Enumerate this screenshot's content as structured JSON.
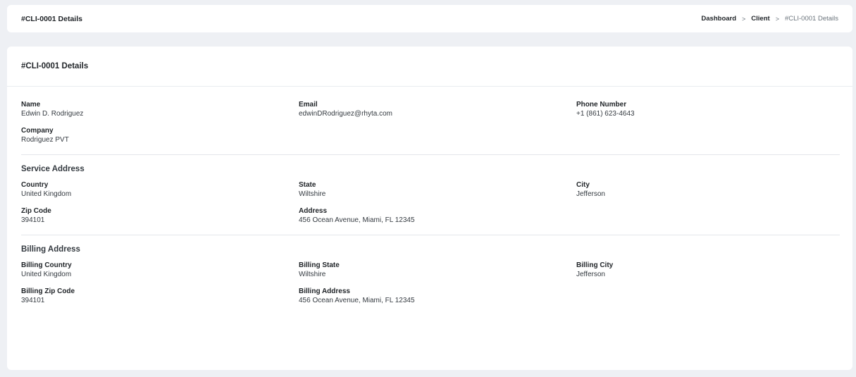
{
  "header": {
    "title": "#CLI-0001 Details",
    "breadcrumb": {
      "dashboard": "Dashboard",
      "client": "Client",
      "current": "#CLI-0001 Details",
      "separator": ">"
    }
  },
  "card": {
    "title": "#CLI-0001 Details"
  },
  "client": {
    "name_label": "Name",
    "name": "Edwin D. Rodriguez",
    "email_label": "Email",
    "email": "edwinDRodriguez@rhyta.com",
    "phone_label": "Phone Number",
    "phone": "+1 (861) 623-4643",
    "company_label": "Company",
    "company": "Rodriguez PVT"
  },
  "service_address": {
    "title": "Service Address",
    "country_label": "Country",
    "country": "United Kingdom",
    "state_label": "State",
    "state": "Wiltshire",
    "city_label": "City",
    "city": "Jefferson",
    "zip_label": "Zip Code",
    "zip": "394101",
    "address_label": "Address",
    "address": "456 Ocean Avenue, Miami, FL 12345"
  },
  "billing_address": {
    "title": "Billing Address",
    "country_label": "Billing Country",
    "country": "United Kingdom",
    "state_label": "Billing State",
    "state": "Wiltshire",
    "city_label": "Billing City",
    "city": "Jefferson",
    "zip_label": "Billing Zip Code",
    "zip": "394101",
    "address_label": "Billing Address",
    "address": "456 Ocean Avenue, Miami, FL 12345"
  }
}
